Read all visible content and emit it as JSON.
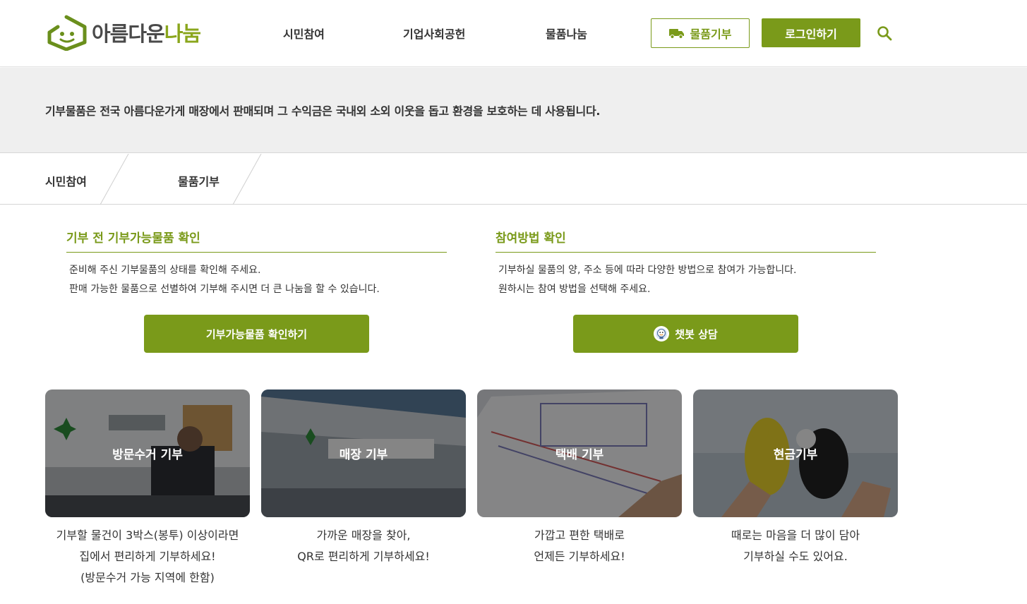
{
  "header": {
    "logo_text_a": "아름다운",
    "logo_text_b": "나눔",
    "nav": [
      "시민참여",
      "기업사회공헌",
      "물품나눔"
    ],
    "donate_label": "물품기부",
    "login_label": "로그인하기"
  },
  "banner": {
    "text": "기부물품은 전국 아름다운가게 매장에서 판매되며 그 수익금은 국내외 소외 이웃을 돕고 환경을 보호하는 데 사용됩니다."
  },
  "breadcrumb": [
    "시민참여",
    "물품기부"
  ],
  "sections": [
    {
      "title": "기부 전 기부가능물품 확인",
      "desc": [
        "준비해 주신 기부물품의 상태를 확인해 주세요.",
        "판매 가능한 물품으로 선별하여 기부해 주시면 더 큰 나눔을 할 수 있습니다."
      ],
      "button": "기부가능물품 확인하기"
    },
    {
      "title": "참여방법 확인",
      "desc": [
        "기부하실 물품의 양, 주소 등에 따라 다양한 방법으로 참여가 가능합니다.",
        "원하시는 참여 방법을 선택해 주세요."
      ],
      "button": "챗봇 상담"
    }
  ],
  "cards": [
    {
      "label": "방문수거 기부",
      "desc": [
        "기부할 물건이 3박스(봉투) 이상이라면",
        "집에서 편리하게 기부하세요!",
        "(방문수거 가능 지역에 한함)"
      ]
    },
    {
      "label": "매장 기부",
      "desc": [
        "가까운 매장을 찾아,",
        "QR로 편리하게 기부하세요!"
      ]
    },
    {
      "label": "택배 기부",
      "desc": [
        "가깝고 편한 택배로",
        "언제든 기부하세요!"
      ]
    },
    {
      "label": "현금기부",
      "desc": [
        "때로는 마음을 더 많이 담아",
        "기부하실 수도 있어요."
      ]
    }
  ],
  "colors": {
    "brand_green": "#7a9a1a",
    "logo_green": "#8aa61c",
    "banner_gray": "#efefef"
  },
  "icons": [
    "logo-icon",
    "truck-icon",
    "search-icon",
    "chatbot-icon"
  ]
}
